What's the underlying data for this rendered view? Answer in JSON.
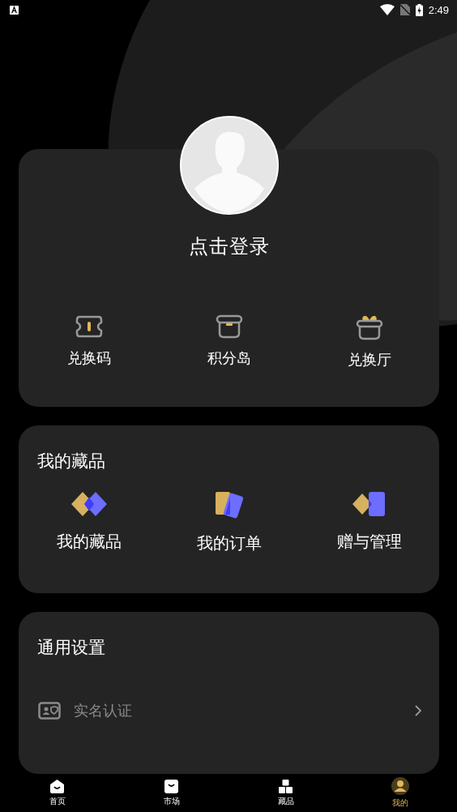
{
  "status_bar": {
    "time": "2:49"
  },
  "profile": {
    "login_label": "点击登录",
    "actions": [
      {
        "kind": "ticket",
        "label": "兑换码"
      },
      {
        "kind": "box",
        "label": "积分岛"
      },
      {
        "kind": "gift",
        "label": "兑换厅"
      }
    ]
  },
  "collections": {
    "title": "我的藏品",
    "items": [
      {
        "kind": "diamonds",
        "label": "我的藏品"
      },
      {
        "kind": "cards",
        "label": "我的订单"
      },
      {
        "kind": "gift-card",
        "label": "赠与管理"
      }
    ]
  },
  "settings": {
    "title": "通用设置",
    "items": [
      {
        "kind": "id-card",
        "label": "实名认证"
      }
    ]
  },
  "nav": [
    {
      "kind": "home",
      "label": "首页",
      "selected": false
    },
    {
      "kind": "bag",
      "label": "市场",
      "selected": false
    },
    {
      "kind": "blocks",
      "label": "藏品",
      "selected": false
    },
    {
      "kind": "avatar",
      "label": "我的",
      "selected": true
    }
  ]
}
